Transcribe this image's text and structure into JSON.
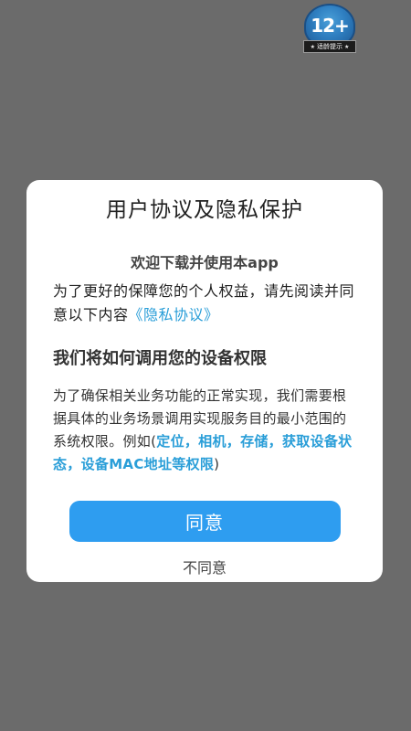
{
  "age_badge": {
    "rating": "12+",
    "caption": "适龄提示"
  },
  "dialog": {
    "title": "用户协议及隐私保护",
    "welcome": "欢迎下载并使用本app",
    "intro_text": "为了更好的保障您的个人权益，请先阅读并同意以下内容",
    "privacy_link": "《隐私协议》",
    "section_title": "我们将如何调用您的设备权限",
    "desc_text": "为了确保相关业务功能的正常实现，我们需要根据具体的业务场景调用实现服务目的最小范围的系统权限。例如(",
    "permissions_text": "定位，相机，存储，获取设备状态，设备MAC地址等权限",
    "desc_close": ")",
    "agree_label": "同意",
    "disagree_label": "不同意"
  },
  "colors": {
    "overlay": "#6b6b6b",
    "accent": "#2e9df0",
    "link": "#2a9ed8"
  }
}
